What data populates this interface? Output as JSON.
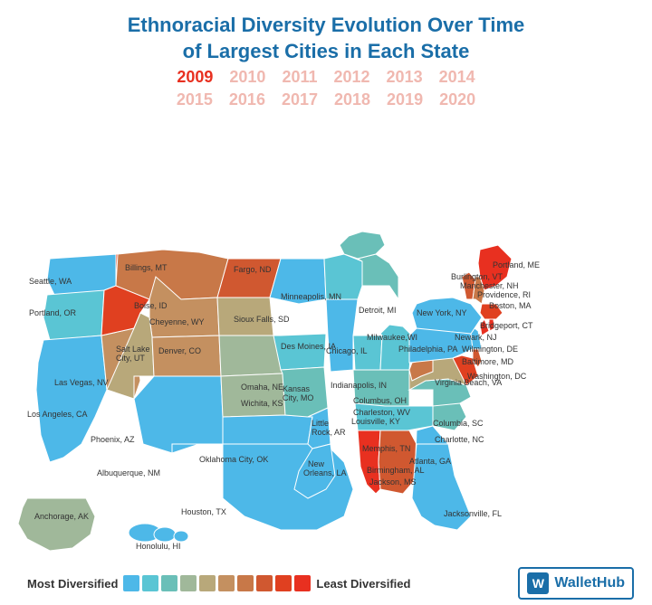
{
  "title": {
    "line1": "Ethnoracial Diversity Evolution Over Time",
    "line2": "of Largest Cities in Each State"
  },
  "years": {
    "row1": [
      "2009",
      "2010",
      "2011",
      "2012",
      "2013",
      "2014"
    ],
    "row2": [
      "2015",
      "2016",
      "2017",
      "2018",
      "2019",
      "2020"
    ],
    "active": "2009"
  },
  "legend": {
    "most_label": "Most Diversified",
    "least_label": "Least Diversified",
    "swatches": [
      "#4db8e8",
      "#5ac5d4",
      "#6abfb8",
      "#a0b89a",
      "#b8a87a",
      "#c49060",
      "#c87848",
      "#d05830",
      "#e04020",
      "#e83020"
    ]
  },
  "logo": {
    "icon": "W",
    "text": "WalletHub"
  },
  "colors": {
    "title_blue": "#1a6ea8",
    "year_active": "#e83020",
    "year_inactive": "#f0b8b0"
  }
}
